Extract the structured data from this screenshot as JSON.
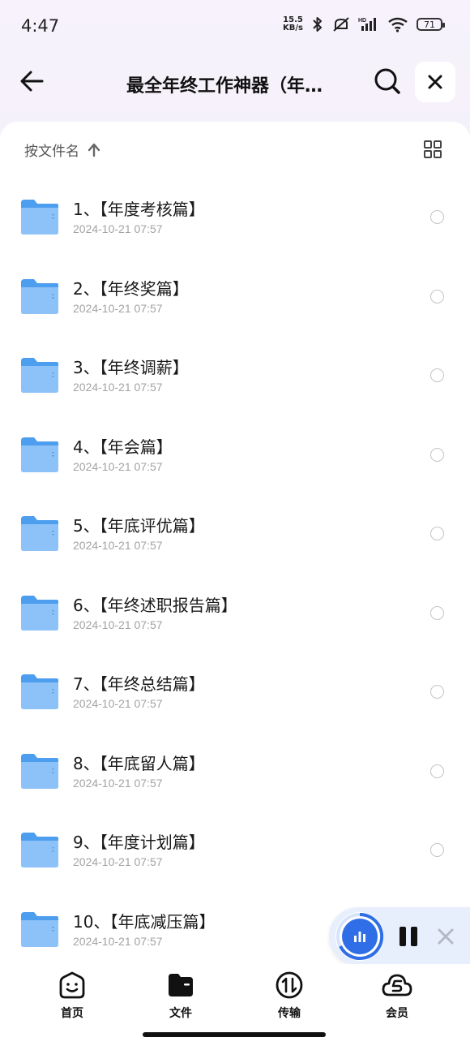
{
  "status_bar": {
    "time": "4:47",
    "net_speed_value": "15.5",
    "net_speed_unit": "KB/s",
    "battery": "71",
    "icons": [
      "bluetooth-icon",
      "mute-icon",
      "signal-icon",
      "wifi-icon",
      "battery-icon"
    ]
  },
  "header": {
    "title": "最全年终工作神器（年…",
    "icons": [
      "back-arrow-icon",
      "search-icon",
      "close-icon"
    ]
  },
  "sort": {
    "label": "按文件名",
    "direction_icon": "arrow-up-icon",
    "view_toggle_icon": "grid-view-icon"
  },
  "files": [
    {
      "name": "1、【年度考核篇】",
      "date": "2024-10-21 07:57"
    },
    {
      "name": "2、【年终奖篇】",
      "date": "2024-10-21 07:57"
    },
    {
      "name": "3、【年终调薪】",
      "date": "2024-10-21 07:57"
    },
    {
      "name": "4、【年会篇】",
      "date": "2024-10-21 07:57"
    },
    {
      "name": "5、【年底评优篇】",
      "date": "2024-10-21 07:57"
    },
    {
      "name": "6、【年终述职报告篇】",
      "date": "2024-10-21 07:57"
    },
    {
      "name": "7、【年终总结篇】",
      "date": "2024-10-21 07:57"
    },
    {
      "name": "8、【年底留人篇】",
      "date": "2024-10-21 07:57"
    },
    {
      "name": "9、【年度计划篇】",
      "date": "2024-10-21 07:57"
    },
    {
      "name": "10、【年底减压篇】",
      "date": "2024-10-21 07:57"
    }
  ],
  "transfer_widget": {
    "icons": [
      "transfer-progress-icon",
      "pause-icon",
      "close-icon"
    ]
  },
  "bottom_nav": [
    {
      "label": "首页",
      "icon": "home-face-icon"
    },
    {
      "label": "文件",
      "icon": "folder-file-icon"
    },
    {
      "label": "传输",
      "icon": "transfer-icon"
    },
    {
      "label": "会员",
      "icon": "vip-cloud-icon"
    }
  ],
  "colors": {
    "accent": "#2f6ee6",
    "folder": "#6fb0f5",
    "header_bg": "#f6f1fa"
  }
}
